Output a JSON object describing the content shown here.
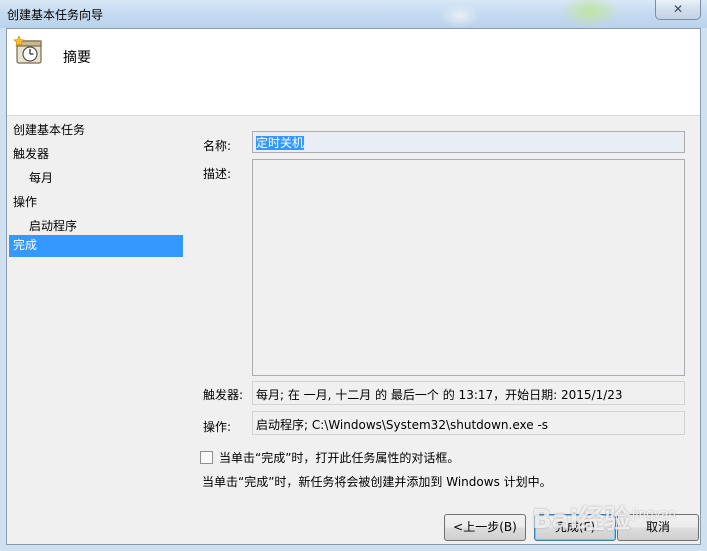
{
  "window": {
    "title": "创建基本任务向导",
    "close_glyph": "✕"
  },
  "header": {
    "heading": "摘要"
  },
  "steps": [
    {
      "label": "创建基本任务"
    },
    {
      "label": "触发器"
    },
    {
      "label": "每月"
    },
    {
      "label": "操作"
    },
    {
      "label": "启动程序"
    },
    {
      "label": "完成"
    }
  ],
  "form": {
    "name_label": "名称:",
    "name_value": "定时关机",
    "desc_label": "描述:",
    "desc_value": "",
    "trigger_label": "触发器:",
    "trigger_value": "每月; 在 一月, 十二月 的 最后一个 的 13:17，开始日期: 2015/1/23",
    "action_label": "操作:",
    "action_value": "启动程序; C:\\Windows\\System32\\shutdown.exe -s",
    "open_props_checkbox": "当单击“完成”时，打开此任务属性的对话框。",
    "open_props_checked": false,
    "note": "当单击“完成”时，新任务将会被创建并添加到 Windows 计划中。"
  },
  "buttons": {
    "back": "<上一步(B)",
    "finish": "完成(F)",
    "cancel": "取消"
  },
  "watermark": {
    "text": "Bai经验",
    "sub": "jingyan"
  },
  "colors": {
    "selection": "#3399ff",
    "dialog_bg": "#f0f0f0"
  }
}
